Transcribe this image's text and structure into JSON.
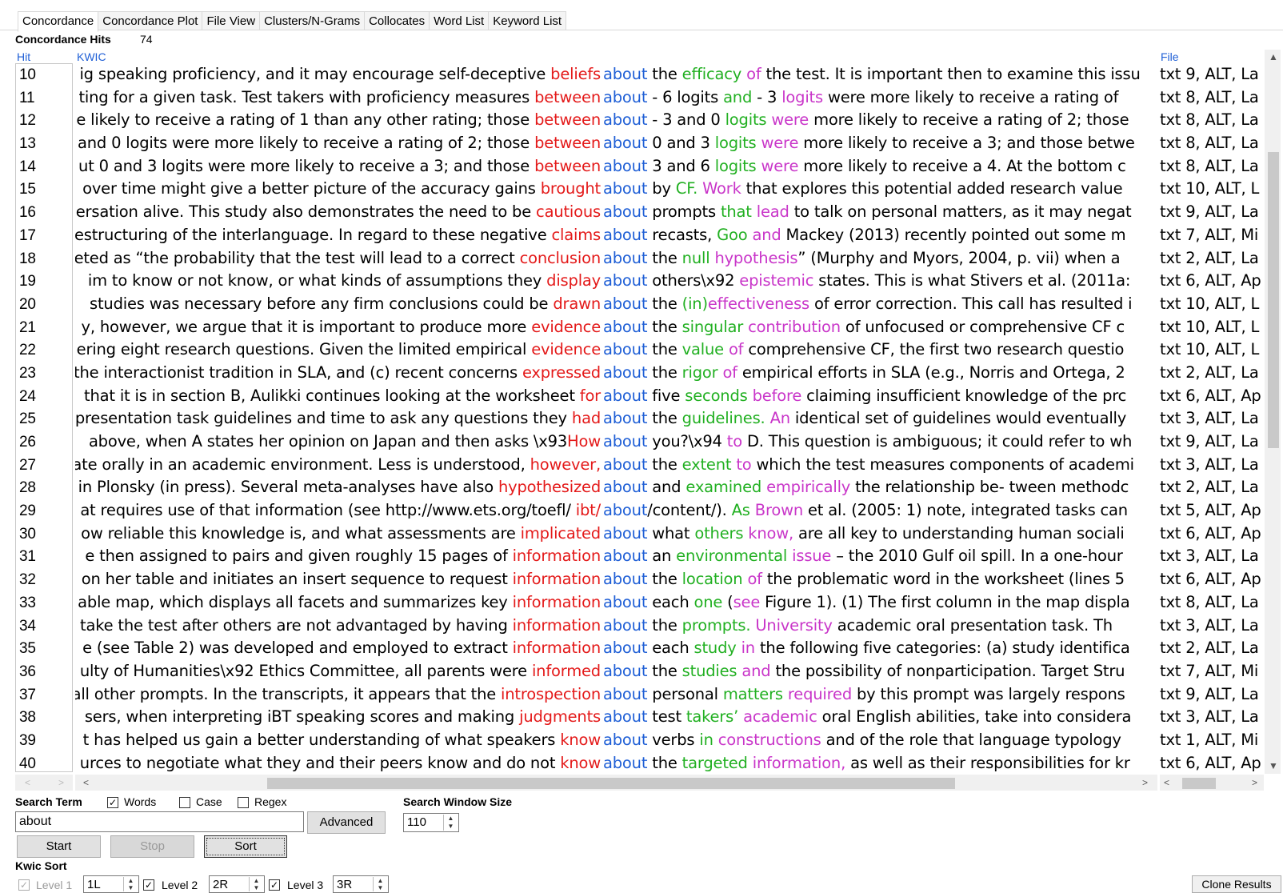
{
  "tabs": [
    "Concordance",
    "Concordance Plot",
    "File View",
    "Clusters/N-Grams",
    "Collocates",
    "Word List",
    "Keyword List"
  ],
  "hits": {
    "label": "Concordance Hits",
    "count": "74"
  },
  "columns": {
    "hit": "Hit",
    "kwic": "KWIC",
    "file": "File"
  },
  "rows": [
    {
      "n": "10",
      "left": [
        [
          "ig speaking proficiency, and it may encourage self-deceptive ",
          ""
        ],
        [
          "beliefs",
          "red"
        ]
      ],
      "kw": "about",
      "right": [
        [
          " the ",
          ""
        ],
        [
          "efficacy",
          "grn"
        ],
        [
          " ",
          ""
        ],
        [
          "of",
          "mag"
        ],
        [
          " the test. It is important then to examine this issu",
          ""
        ]
      ],
      "file": "txt 9, ALT, La"
    },
    {
      "n": "11",
      "left": [
        [
          "ting for a given task. Test takers with proficiency measures ",
          ""
        ],
        [
          "between",
          "red"
        ]
      ],
      "kw": "about",
      "right": [
        [
          " - 6 logits ",
          ""
        ],
        [
          "and",
          "grn"
        ],
        [
          " - 3 ",
          ""
        ],
        [
          "logits",
          "mag"
        ],
        [
          " were more likely to receive a rating of",
          ""
        ]
      ],
      "file": "txt 8, ALT, La"
    },
    {
      "n": "12",
      "left": [
        [
          "e likely to receive a rating of 1 than any other rating; those ",
          ""
        ],
        [
          "between",
          "red"
        ]
      ],
      "kw": "about",
      "right": [
        [
          " - 3 and 0 ",
          ""
        ],
        [
          "logits",
          "grn"
        ],
        [
          " ",
          ""
        ],
        [
          "were",
          "mag"
        ],
        [
          " more likely to receive a rating of 2; those",
          ""
        ]
      ],
      "file": "txt 8, ALT, La"
    },
    {
      "n": "13",
      "left": [
        [
          "and 0 logits were more likely to receive a rating of 2; those ",
          ""
        ],
        [
          "between",
          "red"
        ]
      ],
      "kw": "about",
      "right": [
        [
          " 0 and 3 ",
          ""
        ],
        [
          "logits",
          "grn"
        ],
        [
          " ",
          ""
        ],
        [
          "were",
          "mag"
        ],
        [
          " more likely to receive a 3; and those betwe",
          ""
        ]
      ],
      "file": "txt 8, ALT, La"
    },
    {
      "n": "14",
      "left": [
        [
          "ut 0 and 3 logits were more likely to receive a 3; and those ",
          ""
        ],
        [
          "between",
          "red"
        ]
      ],
      "kw": "about",
      "right": [
        [
          " 3 and 6 ",
          ""
        ],
        [
          "logits",
          "grn"
        ],
        [
          " ",
          ""
        ],
        [
          "were",
          "mag"
        ],
        [
          " more likely to receive a 4.  At the bottom c",
          ""
        ]
      ],
      "file": "txt 8, ALT, La"
    },
    {
      "n": "15",
      "left": [
        [
          " over time might give a better picture of the accuracy gains ",
          ""
        ],
        [
          "brought",
          "red"
        ]
      ],
      "kw": "about",
      "right": [
        [
          " by ",
          ""
        ],
        [
          "CF.",
          "grn"
        ],
        [
          " ",
          ""
        ],
        [
          "Work",
          "mag"
        ],
        [
          " that explores this potential added research value",
          ""
        ]
      ],
      "file": "txt 10, ALT, L"
    },
    {
      "n": "16",
      "left": [
        [
          "ersation alive. This study also demonstrates the need to be ",
          ""
        ],
        [
          "cautious",
          "red"
        ]
      ],
      "kw": "about",
      "right": [
        [
          " prompts ",
          ""
        ],
        [
          "that",
          "grn"
        ],
        [
          " ",
          ""
        ],
        [
          "lead",
          "mag"
        ],
        [
          " to talk on personal matters, as it may negat",
          ""
        ]
      ],
      "file": "txt 9, ALT, La"
    },
    {
      "n": "17",
      "left": [
        [
          "estructuring of the interlanguage. In regard to these negative ",
          ""
        ],
        [
          "claims",
          "red"
        ]
      ],
      "kw": "about",
      "right": [
        [
          " recasts, ",
          ""
        ],
        [
          "Goo",
          "grn"
        ],
        [
          " ",
          ""
        ],
        [
          "and",
          "mag"
        ],
        [
          " Mackey (2013) recently pointed out some m",
          ""
        ]
      ],
      "file": "txt 7, ALT, Mi"
    },
    {
      "n": "18",
      "left": [
        [
          "eted as “the probability that the test will lead to a correct ",
          ""
        ],
        [
          "conclusion",
          "red"
        ]
      ],
      "kw": "about",
      "right": [
        [
          " the ",
          ""
        ],
        [
          "null",
          "grn"
        ],
        [
          " ",
          ""
        ],
        [
          "hypothesis",
          "mag"
        ],
        [
          "” (Murphy and Myors, 2004, p. vii) when a ",
          ""
        ]
      ],
      "file": "txt 2, ALT, La"
    },
    {
      "n": "19",
      "left": [
        [
          "im to know or not know, or what kinds of assumptions they ",
          ""
        ],
        [
          "display",
          "red"
        ]
      ],
      "kw": "about",
      "right": [
        [
          " others\\x92 ",
          ""
        ],
        [
          "epistemic",
          "mag"
        ],
        [
          " states. This is what Stivers et al. (2011a:",
          ""
        ]
      ],
      "file": "txt 6, ALT, Ap"
    },
    {
      "n": "20",
      "left": [
        [
          " studies was necessary before any firm conclusions could be ",
          ""
        ],
        [
          "drawn",
          "red"
        ]
      ],
      "kw": "about",
      "right": [
        [
          " the ",
          ""
        ],
        [
          "(in)",
          "grn"
        ],
        [
          "effectiveness",
          "mag"
        ],
        [
          " of error correction. This call has resulted i",
          ""
        ]
      ],
      "file": "txt 10, ALT, L"
    },
    {
      "n": "21",
      "left": [
        [
          "y, however, we argue that it is important to produce more ",
          ""
        ],
        [
          "evidence",
          "red"
        ]
      ],
      "kw": "about",
      "right": [
        [
          " the ",
          ""
        ],
        [
          "singular",
          "grn"
        ],
        [
          " ",
          ""
        ],
        [
          "contribution",
          "mag"
        ],
        [
          " of unfocused or comprehensive CF c",
          ""
        ]
      ],
      "file": "txt 10, ALT, L"
    },
    {
      "n": "22",
      "left": [
        [
          "ering eight research questions.  Given the limited empirical ",
          ""
        ],
        [
          "evidence",
          "red"
        ]
      ],
      "kw": "about",
      "right": [
        [
          " the ",
          ""
        ],
        [
          "value",
          "grn"
        ],
        [
          " ",
          ""
        ],
        [
          "of",
          "mag"
        ],
        [
          " comprehensive CF, the first two research questio",
          ""
        ]
      ],
      "file": "txt 10, ALT, L"
    },
    {
      "n": "23",
      "left": [
        [
          "the interactionist tradition in SLA, and (c) recent concerns ",
          ""
        ],
        [
          "expressed",
          "red"
        ]
      ],
      "kw": "about",
      "right": [
        [
          " the ",
          ""
        ],
        [
          "rigor",
          "grn"
        ],
        [
          " ",
          ""
        ],
        [
          "of",
          "mag"
        ],
        [
          " empirical efforts in SLA (e.g., Norris and Ortega, 2",
          ""
        ]
      ],
      "file": "txt 2, ALT, La"
    },
    {
      "n": "24",
      "left": [
        [
          " that it is in section B, Aulikki continues looking at the worksheet ",
          ""
        ],
        [
          "for",
          "red"
        ]
      ],
      "kw": "about",
      "right": [
        [
          " five ",
          ""
        ],
        [
          "seconds",
          "grn"
        ],
        [
          " ",
          ""
        ],
        [
          "before",
          "mag"
        ],
        [
          " claiming insufficient knowledge of the prc",
          ""
        ]
      ],
      "file": "txt 6, ALT, Ap"
    },
    {
      "n": "25",
      "left": [
        [
          "presentation task guidelines and time to ask any questions they ",
          ""
        ],
        [
          "had",
          "red"
        ]
      ],
      "kw": "about",
      "right": [
        [
          " the ",
          ""
        ],
        [
          "guidelines.",
          "grn"
        ],
        [
          " ",
          ""
        ],
        [
          "An",
          "mag"
        ],
        [
          " identical set of guidelines would eventually",
          ""
        ]
      ],
      "file": "txt 3, ALT, La"
    },
    {
      "n": "26",
      "left": [
        [
          " above, when A states her opinion on Japan and then asks \\x93",
          ""
        ],
        [
          "How",
          "red"
        ]
      ],
      "kw": "about",
      "right": [
        [
          " you?\\x94 ",
          ""
        ],
        [
          "to",
          "mag"
        ],
        [
          " D. This question is ambiguous; it could refer to wh",
          ""
        ]
      ],
      "file": "txt 9, ALT, La"
    },
    {
      "n": "27",
      "left": [
        [
          "ate orally in an academic environment. Less is understood, ",
          ""
        ],
        [
          "however,",
          "red"
        ]
      ],
      "kw": "about",
      "right": [
        [
          " the ",
          ""
        ],
        [
          "extent",
          "grn"
        ],
        [
          " ",
          ""
        ],
        [
          "to",
          "mag"
        ],
        [
          " which the test measures components of academi",
          ""
        ]
      ],
      "file": "txt 3, ALT, La"
    },
    {
      "n": "28",
      "left": [
        [
          "in Plonsky (in press). Several meta-analyses have also ",
          ""
        ],
        [
          "hypothesized",
          "red"
        ]
      ],
      "kw": "about",
      "right": [
        [
          " and ",
          ""
        ],
        [
          "examined",
          "grn"
        ],
        [
          " ",
          ""
        ],
        [
          "empirically",
          "mag"
        ],
        [
          " the relationship be- tween methodc",
          ""
        ]
      ],
      "file": "txt 2, ALT, La"
    },
    {
      "n": "29",
      "left": [
        [
          "at requires use of that information (see http://www.ets.org/toefl/ ",
          ""
        ],
        [
          "ibt/",
          "red"
        ]
      ],
      "kw": "about",
      "right": [
        [
          "/content/). ",
          ""
        ],
        [
          "As",
          "grn"
        ],
        [
          " ",
          ""
        ],
        [
          "Brown",
          "mag"
        ],
        [
          " et al. (2005: 1) note, integrated tasks can",
          ""
        ]
      ],
      "file": "txt 5, ALT, Ap"
    },
    {
      "n": "30",
      "left": [
        [
          "ow reliable this knowledge is, and what assessments are ",
          ""
        ],
        [
          "implicated",
          "red"
        ]
      ],
      "kw": "about",
      "right": [
        [
          " what ",
          ""
        ],
        [
          "others",
          "grn"
        ],
        [
          " ",
          ""
        ],
        [
          "know,",
          "mag"
        ],
        [
          " are all key to understanding human sociali",
          ""
        ]
      ],
      "file": "txt 6, ALT, Ap"
    },
    {
      "n": "31",
      "left": [
        [
          "e then assigned to pairs and given roughly 15 pages of ",
          ""
        ],
        [
          "information",
          "red"
        ]
      ],
      "kw": "about",
      "right": [
        [
          " an ",
          ""
        ],
        [
          "environmental",
          "grn"
        ],
        [
          " ",
          ""
        ],
        [
          "issue",
          "mag"
        ],
        [
          " – the 2010 Gulf oil spill. In a one-hour",
          ""
        ]
      ],
      "file": "txt 3, ALT, La"
    },
    {
      "n": "32",
      "left": [
        [
          "on her table and initiates an insert sequence to request ",
          ""
        ],
        [
          "information",
          "red"
        ]
      ],
      "kw": "about",
      "right": [
        [
          " the ",
          ""
        ],
        [
          "location",
          "grn"
        ],
        [
          " ",
          ""
        ],
        [
          "of",
          "mag"
        ],
        [
          " the problematic word in the worksheet (lines 5",
          ""
        ]
      ],
      "file": "txt 6, ALT, Ap"
    },
    {
      "n": "33",
      "left": [
        [
          "able map, which displays all facets and summarizes key ",
          ""
        ],
        [
          "information",
          "red"
        ]
      ],
      "kw": "about",
      "right": [
        [
          " each ",
          ""
        ],
        [
          "one",
          "grn"
        ],
        [
          " (",
          ""
        ],
        [
          "see",
          "mag"
        ],
        [
          " Figure 1).  (1) The first column in the map displa",
          ""
        ]
      ],
      "file": "txt 8, ALT, La"
    },
    {
      "n": "34",
      "left": [
        [
          "take the test after others are not advantaged by having ",
          ""
        ],
        [
          "information",
          "red"
        ]
      ],
      "kw": "about",
      "right": [
        [
          " the ",
          ""
        ],
        [
          "prompts.",
          "grn"
        ],
        [
          "   ",
          ""
        ],
        [
          "University",
          "mag"
        ],
        [
          " academic oral presentation task.   Th",
          ""
        ]
      ],
      "file": "txt 3, ALT, La"
    },
    {
      "n": "35",
      "left": [
        [
          "e (see Table 2) was developed and employed to extract ",
          ""
        ],
        [
          "information",
          "red"
        ]
      ],
      "kw": "about",
      "right": [
        [
          " each ",
          ""
        ],
        [
          "study",
          "grn"
        ],
        [
          " ",
          ""
        ],
        [
          "in",
          "mag"
        ],
        [
          " the following five categories: (a) study identifica",
          ""
        ]
      ],
      "file": "txt 2, ALT, La"
    },
    {
      "n": "36",
      "left": [
        [
          "ulty of Humanities\\x92 Ethics Committee, all parents were ",
          ""
        ],
        [
          "informed",
          "red"
        ]
      ],
      "kw": "about",
      "right": [
        [
          " the ",
          ""
        ],
        [
          "studies",
          "grn"
        ],
        [
          " ",
          ""
        ],
        [
          "and",
          "mag"
        ],
        [
          " the possibility of nonparticipation.  Target Stru",
          ""
        ]
      ],
      "file": "txt 7, ALT, Mi"
    },
    {
      "n": "37",
      "left": [
        [
          "all other prompts. In the transcripts, it appears that the ",
          ""
        ],
        [
          "introspection",
          "red"
        ]
      ],
      "kw": "about",
      "right": [
        [
          " personal ",
          ""
        ],
        [
          "matters",
          "grn"
        ],
        [
          " ",
          ""
        ],
        [
          "required",
          "mag"
        ],
        [
          " by this prompt was largely respons",
          ""
        ]
      ],
      "file": "txt 9, ALT, La"
    },
    {
      "n": "38",
      "left": [
        [
          "sers, when interpreting iBT speaking scores and making ",
          ""
        ],
        [
          "judgments",
          "red"
        ]
      ],
      "kw": "about",
      "right": [
        [
          " test ",
          ""
        ],
        [
          "takers’",
          "grn"
        ],
        [
          " ",
          ""
        ],
        [
          "academic",
          "mag"
        ],
        [
          " oral English abilities, take into considera",
          ""
        ]
      ],
      "file": "txt 3, ALT, La"
    },
    {
      "n": "39",
      "left": [
        [
          "t has helped us gain a better understanding of what speakers ",
          ""
        ],
        [
          "know",
          "red"
        ]
      ],
      "kw": "about",
      "right": [
        [
          " verbs ",
          ""
        ],
        [
          "in",
          "grn"
        ],
        [
          " ",
          ""
        ],
        [
          "constructions",
          "mag"
        ],
        [
          " and of the role that language typology",
          ""
        ]
      ],
      "file": "txt 1, ALT, Mi"
    },
    {
      "n": "40",
      "left": [
        [
          "urces to negotiate what they and their peers know and do not ",
          ""
        ],
        [
          "know",
          "red"
        ]
      ],
      "kw": "about",
      "right": [
        [
          " the ",
          ""
        ],
        [
          "targeted",
          "grn"
        ],
        [
          " ",
          ""
        ],
        [
          "information,",
          "mag"
        ],
        [
          " as well as their responsibilities for kr",
          ""
        ]
      ],
      "file": "txt 6, ALT, Ap"
    }
  ],
  "search": {
    "term_label": "Search Term",
    "words_label": "Words",
    "words_checked": true,
    "case_label": "Case",
    "case_checked": false,
    "regex_label": "Regex",
    "regex_checked": false,
    "value": "about",
    "advanced_label": "Advanced",
    "window_label": "Search Window Size",
    "window_value": "110"
  },
  "buttons": {
    "start": "Start",
    "stop": "Stop",
    "sort": "Sort",
    "clone": "Clone Results"
  },
  "kwic_sort": {
    "label": "Kwic Sort",
    "level1_label": "Level 1",
    "level1_value": "1L",
    "level2_label": "Level 2",
    "level2_value": "2R",
    "level3_label": "Level 3",
    "level3_value": "3R"
  },
  "colors": {
    "keyword": "#1f5fd6",
    "left1": "#e41a1a",
    "right1": "#22b022",
    "right2": "#c936c9"
  }
}
